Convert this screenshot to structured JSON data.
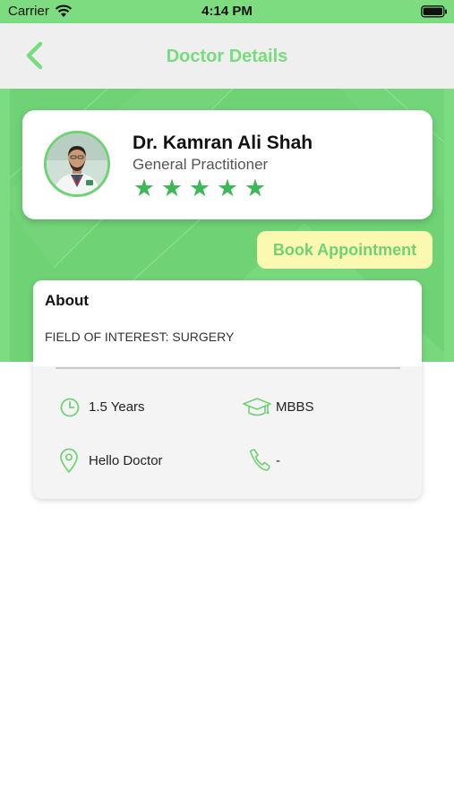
{
  "status_bar": {
    "carrier": "Carrier",
    "time": "4:14 PM"
  },
  "nav": {
    "title": "Doctor Details",
    "back_icon": "chevron-left-icon"
  },
  "doctor": {
    "name": "Dr. Kamran Ali Shah",
    "specialty": "General Practitioner",
    "rating": 5,
    "rating_max": 5
  },
  "actions": {
    "book_label": "Book Appointment"
  },
  "about": {
    "title": "About",
    "interest": "FIELD OF INTEREST: SURGERY",
    "experience": "1.5 Years",
    "degree": "MBBS",
    "location": "Hello Doctor",
    "phone": "-"
  },
  "colors": {
    "brand_green": "#6fd275",
    "title_green": "#78dc7e",
    "star_green": "#3db858",
    "book_button_bg": "#fbf8b2"
  }
}
